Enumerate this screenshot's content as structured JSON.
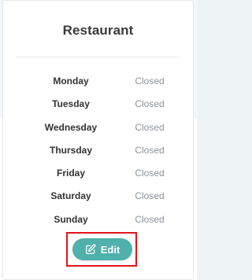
{
  "card": {
    "title": "Restaurant"
  },
  "hours": [
    {
      "day": "Monday",
      "status": "Closed"
    },
    {
      "day": "Tuesday",
      "status": "Closed"
    },
    {
      "day": "Wednesday",
      "status": "Closed"
    },
    {
      "day": "Thursday",
      "status": "Closed"
    },
    {
      "day": "Friday",
      "status": "Closed"
    },
    {
      "day": "Saturday",
      "status": "Closed"
    },
    {
      "day": "Sunday",
      "status": "Closed"
    }
  ],
  "actions": {
    "edit_label": "Edit",
    "edit_icon": "edit-square-pencil-icon"
  },
  "colors": {
    "accent": "#4fb0ac",
    "highlight": "#e0141c"
  }
}
